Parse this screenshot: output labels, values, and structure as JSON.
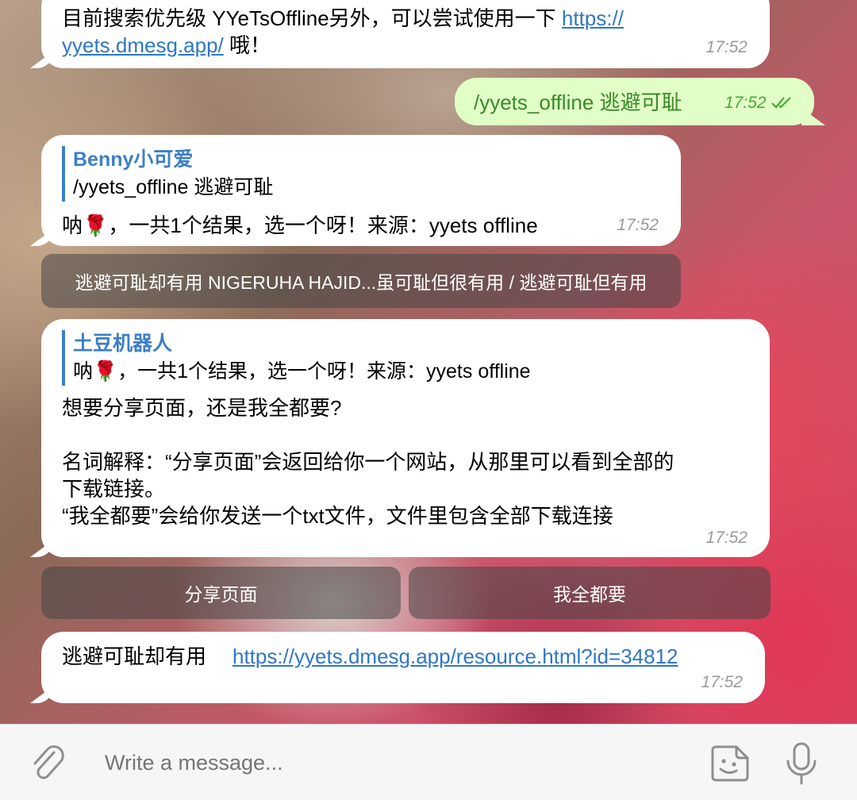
{
  "messages": {
    "m1": {
      "text_line1": "目前搜索优先级 YYeTsOffline另外，可以尝试使用一下",
      "link_line1": "https://",
      "link_line2": "yyets.dmesg.app/",
      "text_after": "哦！",
      "time": "17:52"
    },
    "m2": {
      "text": "/yyets_offline 逃避可耻",
      "time": "17:52"
    },
    "m3": {
      "reply_author": "Benny小可爱",
      "reply_text": "/yyets_offline 逃避可耻",
      "text": "呐🌹，一共1个结果，选一个呀！来源：yyets offline",
      "time": "17:52"
    },
    "button1": {
      "label": "逃避可耻却有用 NIGERUHA HAJID...虽可耻但很有用 / 逃避可耻但有用"
    },
    "m4": {
      "reply_author": "土豆机器人",
      "reply_text": "呐🌹，一共1个结果，选一个呀！来源：yyets offline",
      "line1": "想要分享页面，还是我全都要?",
      "line2": "名词解释：“分享页面”会返回给你一个网站，从那里可以看到全部的",
      "line3": "下载链接。",
      "line4": "“我全都要”会给你发送一个txt文件，文件里包含全部下载连接",
      "time": "17:52"
    },
    "buttons2": {
      "left_label": "分享页面",
      "right_label": "我全都要"
    },
    "m5": {
      "text": "逃避可耻却有用",
      "link": "https://yyets.dmesg.app/resource.html?id=34812",
      "time": "17:52"
    }
  },
  "composer": {
    "placeholder": "Write a message..."
  },
  "icons": {
    "attach": "paperclip-icon",
    "sticker": "sticker-icon",
    "mic": "microphone-icon",
    "read": "double-check-icon"
  },
  "colors": {
    "link": "#2f77c6",
    "outgoing_bubble": "#e1fec6",
    "outgoing_text": "#3a8a2a",
    "reply_accent": "#3c7fc7"
  }
}
